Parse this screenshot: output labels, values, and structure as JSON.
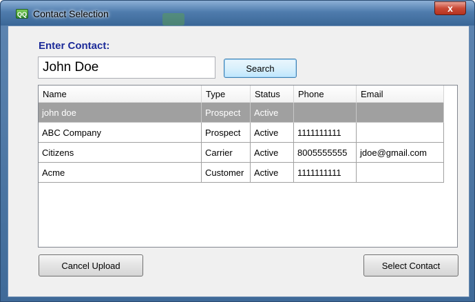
{
  "window": {
    "title": "Contact Selection",
    "close_glyph": "x",
    "app_icon_text": "QQ"
  },
  "form": {
    "label": "Enter Contact:",
    "contact_value": "John Doe",
    "search_label": "Search"
  },
  "grid": {
    "columns": [
      "Name",
      "Type",
      "Status",
      "Phone",
      "Email"
    ],
    "selected_row": 0,
    "rows": [
      {
        "name": "john doe",
        "type": "Prospect",
        "status": "Active",
        "phone": "",
        "email": ""
      },
      {
        "name": "ABC Company",
        "type": "Prospect",
        "status": "Active",
        "phone": "1111111111",
        "email": ""
      },
      {
        "name": "Citizens",
        "type": "Carrier",
        "status": "Active",
        "phone": "8005555555",
        "email": "jdoe@gmail.com"
      },
      {
        "name": "Acme",
        "type": "Customer",
        "status": "Active",
        "phone": "1111111111",
        "email": ""
      }
    ]
  },
  "footer": {
    "cancel_label": "Cancel Upload",
    "select_label": "Select Contact"
  },
  "colors": {
    "accent_label": "#1c2b99",
    "selected_row": "#a0a0a0"
  }
}
